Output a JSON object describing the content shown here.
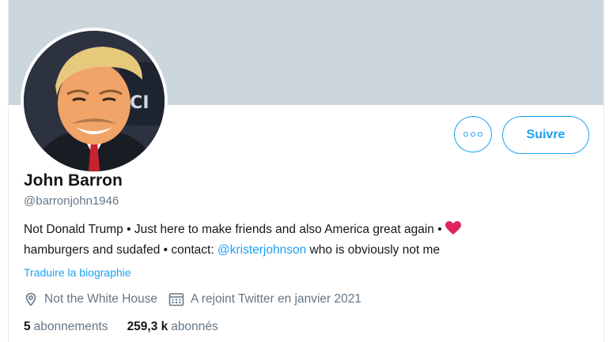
{
  "profile": {
    "name": "John Barron",
    "handle": "@barronjohn1946",
    "bio": {
      "line1": "Not Donald Trump • Just here to make friends and also America great again •",
      "line2_prefix": "hamburgers and sudafed • contact:",
      "mention": "@kristerjohnson",
      "line2_suffix": "who is obviously not me"
    },
    "translate_link": "Traduire la biographie",
    "location": "Not the White House",
    "joined": "A rejoint Twitter en janvier 2021",
    "following_count": "5",
    "following_label": "abonnements",
    "followers_count": "259,3 k",
    "followers_label": "abonnés"
  },
  "actions": {
    "follow_label": "Suivre"
  },
  "icons": {
    "more": "more-options-icon",
    "heart": "heart-icon",
    "location": "location-pin-icon",
    "calendar": "calendar-icon"
  },
  "colors": {
    "accent": "#1da1f2",
    "banner": "#ccd6dd",
    "secondary_text": "#657786",
    "heart": "#e0245e"
  }
}
